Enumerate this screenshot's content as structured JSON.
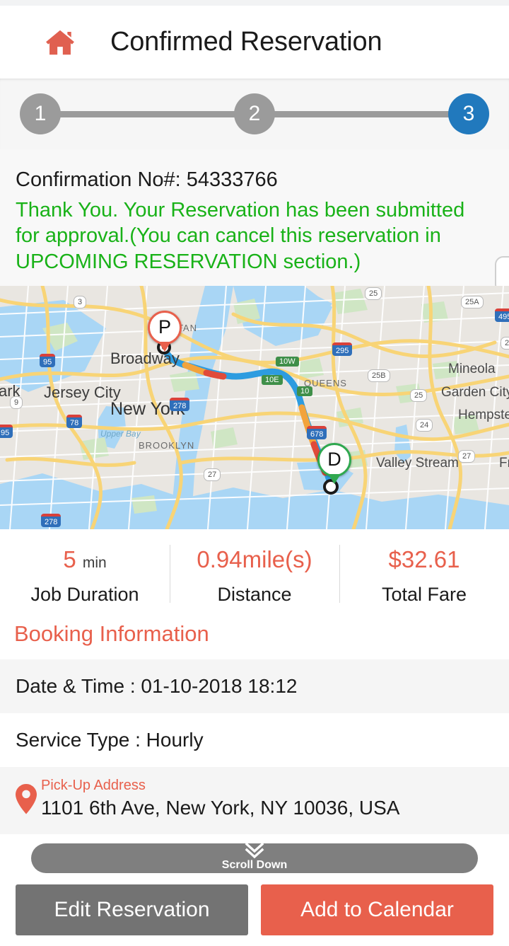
{
  "header": {
    "home_icon": "home-icon",
    "title": "Confirmed Reservation"
  },
  "stepper": {
    "steps": [
      {
        "label": "1",
        "state": "inactive"
      },
      {
        "label": "2",
        "state": "inactive"
      },
      {
        "label": "3",
        "state": "active"
      }
    ],
    "active_color": "#2179bd",
    "inactive_color": "#9b9b9b"
  },
  "confirmation": {
    "number_line": "Confirmation No#: 54333766",
    "message": "Thank You. Your Reservation has been submitted for approval.(You can cancel this reservation in UPCOMING RESERVATION section.)",
    "message_color": "#19b218"
  },
  "map": {
    "pickup_marker": "P",
    "dropoff_marker": "D",
    "labels": [
      "Broadway",
      "Jersey City",
      "New York",
      "ark",
      "BROOKLYN",
      "TTAN",
      "QUEENS",
      "Mineola",
      "Garden City",
      "Hempstead",
      "Valley Stream",
      "Upper Bay",
      "Fre"
    ],
    "route_shields": [
      "3",
      "95",
      "9",
      "278",
      "278",
      "27",
      "10W",
      "10E",
      "10",
      "295",
      "678",
      "25A",
      "25B",
      "25",
      "24",
      "27",
      "495",
      "25"
    ]
  },
  "stats": [
    {
      "value": "5",
      "unit": "min",
      "label": "Job Duration"
    },
    {
      "value": "0.94mile(s)",
      "unit": "",
      "label": "Distance"
    },
    {
      "value": "$32.61",
      "unit": "",
      "label": "Total Fare"
    }
  ],
  "booking": {
    "section_title": "Booking Information",
    "date_time": "Date & Time : 01-10-2018 18:12",
    "service_type": "Service Type : Hourly",
    "pickup_label": "Pick-Up Address",
    "pickup_address": "1101 6th Ave, New York, NY 10036, USA"
  },
  "scroll_hint": {
    "label": "Scroll Down",
    "icon": "double-chevron-down-icon"
  },
  "actions": {
    "edit_label": "Edit Reservation",
    "calendar_label": "Add to Calendar",
    "edit_color": "#737373",
    "calendar_color": "#e8604c"
  },
  "theme": {
    "accent": "#e8604c",
    "success": "#19b218",
    "primary_blue": "#2179bd"
  }
}
